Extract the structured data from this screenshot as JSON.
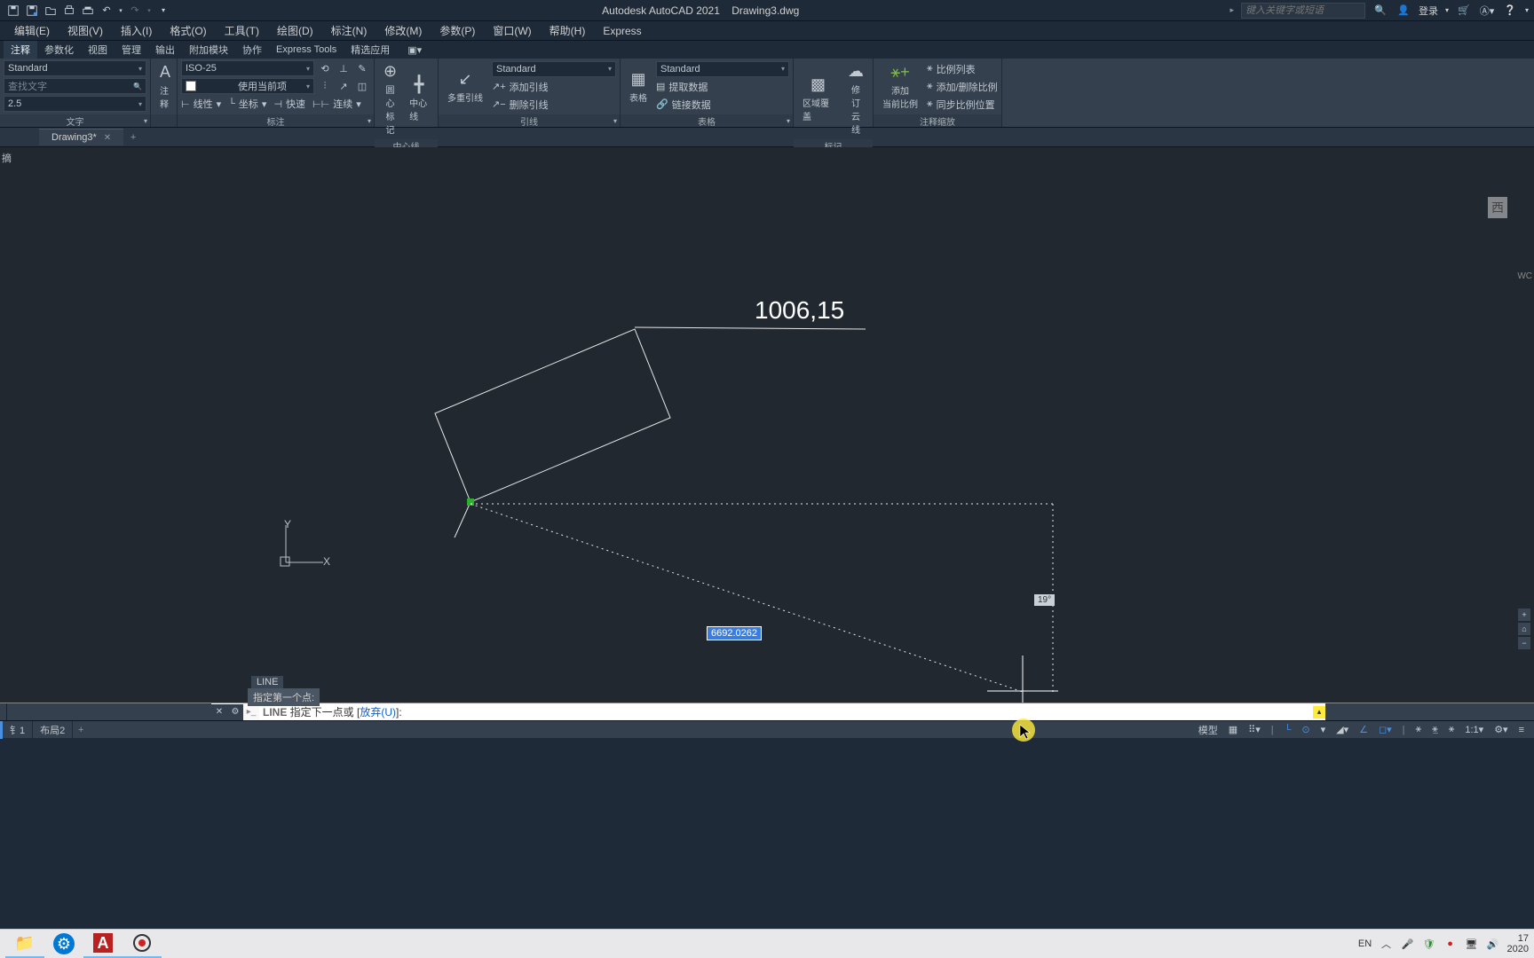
{
  "app": {
    "name": "Autodesk AutoCAD 2021",
    "file": "Drawing3.dwg"
  },
  "search": {
    "placeholder": "键入关键字或短语"
  },
  "login": {
    "label": "登录"
  },
  "menus": [
    "编辑(E)",
    "视图(V)",
    "插入(I)",
    "格式(O)",
    "工具(T)",
    "绘图(D)",
    "标注(N)",
    "修改(M)",
    "参数(P)",
    "窗口(W)",
    "帮助(H)",
    "Express"
  ],
  "ribbon_tabs": [
    "注释",
    "参数化",
    "视图",
    "管理",
    "输出",
    "附加模块",
    "协作",
    "Express Tools",
    "精选应用"
  ],
  "panel_text": {
    "style_std": "Standard",
    "find_placeholder": "查找文字",
    "height_value": "2.5",
    "p1_title": "文字",
    "dim_style": "ISO-25",
    "use_current": "使用当前项",
    "linear": "线性",
    "baseline": "坐标",
    "quick": "快速",
    "continue": "连续",
    "ann_btn": "注释",
    "p2_title": "标注",
    "center_mark": "圆心\n标记",
    "center_line": "中心线",
    "p3_title": "中心线",
    "mleader": "多重引线",
    "mleader_style": "Standard",
    "add_leader": "添加引线",
    "del_leader": "删除引线",
    "p4_title": "引线",
    "table": "表格",
    "table_style": "Standard",
    "extract": "提取数据",
    "link": "链接数据",
    "p5_title": "表格",
    "wipeout": "区域覆盖",
    "revcloud": "修订\n云线",
    "p6_title": "标记",
    "addscale": "添加\n当前比例",
    "scale_list": "比例列表",
    "add_del_scale": "添加/删除比例",
    "sync_scale": "同步比例位置",
    "p7_title": "注释缩放"
  },
  "doctab": {
    "name": "Drawing3*"
  },
  "canvas": {
    "side_label": "摘",
    "ucs_y": "Y",
    "ucs_x": "X",
    "dim_value": "1006,15",
    "dyn_len": "6692.0262",
    "dyn_angle": "19°",
    "cmd_name": "LINE",
    "cmd_prompt": "指定第一个点:",
    "nav_face": "西",
    "nav_wcs": "WC"
  },
  "cmdline": {
    "cmd": "LINE",
    "text1": " 指定下一点或 [",
    "opt": "放弃(U)",
    "text2": "]:"
  },
  "layouts": {
    "t1": "钅1",
    "t2": "布局2"
  },
  "status": {
    "model": "模型",
    "scale": "1:1"
  },
  "tray": {
    "ime": "EN",
    "time1": "17",
    "time2": "2020"
  }
}
